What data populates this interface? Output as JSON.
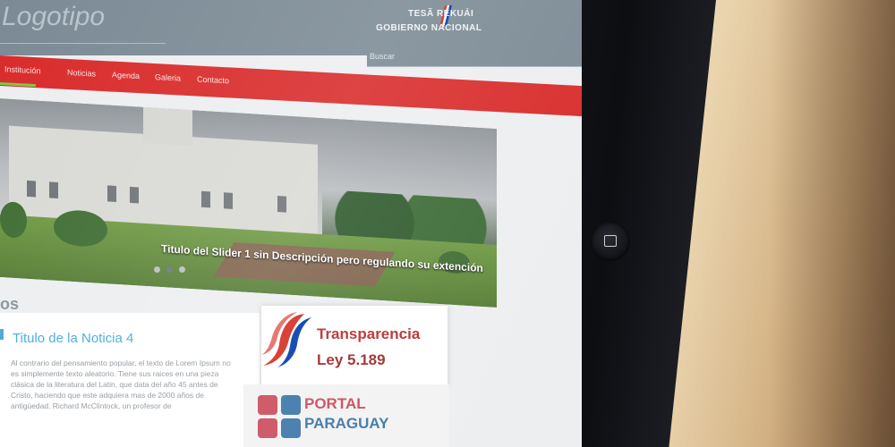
{
  "header": {
    "logo_text": "Logotipo",
    "gov_line1": "TESÃ RÉKUÁI",
    "gov_line2": "GOBIERNO NACIONAL",
    "search_label": "Buscar"
  },
  "nav": {
    "items": [
      "Institución",
      "Noticias",
      "Agenda",
      "Galeria",
      "Contacto"
    ]
  },
  "slider": {
    "caption": "Titulo del Slider 1 sin Descripción pero regulando su extención",
    "slides_count": 3,
    "active_index": 1
  },
  "section": {
    "title_fragment": "os"
  },
  "news": {
    "title": "Titulo de la Noticia 4",
    "body": "Al contrario del pensamiento popular, el texto de Lorem Ipsum no es simplemente texto aleatorio. Tiene sus raices en una pieza clásica de la literatura del Latin, que data del año 45 antes de Cristo, haciendo que este adquiera mas de 2000 años de antigüedad. Richard McClintock, un profesor de"
  },
  "banners": {
    "transparencia_title": "Transparencia",
    "transparencia_law": "Ley 5.189",
    "portal_line1": "PORTAL",
    "portal_line2": "PARAGUAY"
  },
  "colors": {
    "header_bg": "#7b8a95",
    "nav_bg": "#d92a2a",
    "news_title": "#45a9dd",
    "transparencia_red": "#b72c2c",
    "portal_blue": "#3a74a8"
  }
}
